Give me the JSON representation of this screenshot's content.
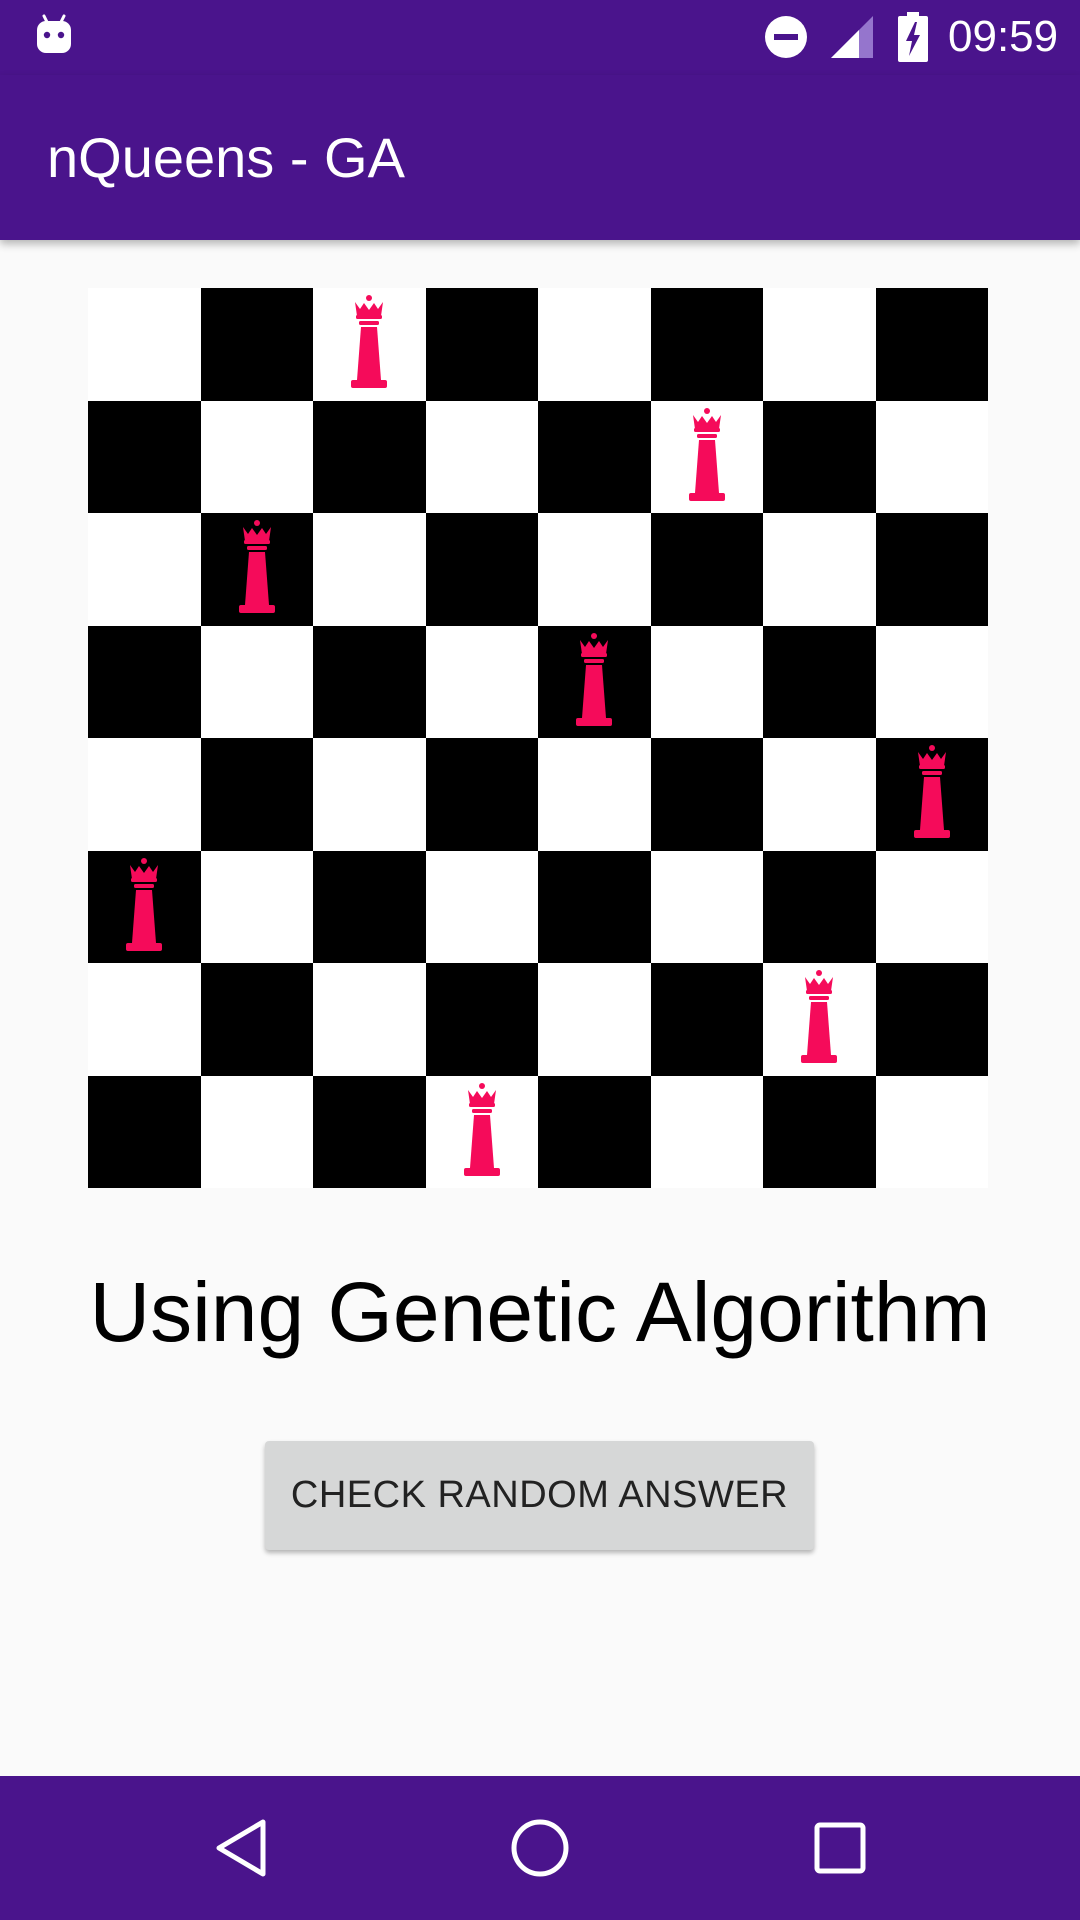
{
  "status_bar": {
    "time": "09:59",
    "icons": [
      "android-debug-icon",
      "do-not-disturb-icon",
      "cell-signal-icon",
      "battery-charging-icon"
    ]
  },
  "app_bar": {
    "title": "nQueens - GA"
  },
  "board": {
    "size": 8,
    "queens": [
      {
        "row": 0,
        "col": 2
      },
      {
        "row": 1,
        "col": 5
      },
      {
        "row": 2,
        "col": 1
      },
      {
        "row": 3,
        "col": 4
      },
      {
        "row": 4,
        "col": 7
      },
      {
        "row": 5,
        "col": 0
      },
      {
        "row": 6,
        "col": 6
      },
      {
        "row": 7,
        "col": 3
      }
    ],
    "piece_icon": "queen-icon",
    "dark_color": "#000000",
    "light_color": "#ffffff",
    "queen_color": "#f50b5a"
  },
  "main": {
    "subtitle": "Using Genetic Algorithm",
    "button_label": "CHECK RANDOM ANSWER"
  },
  "nav_bar": {
    "icons": [
      "back-icon",
      "home-icon",
      "recents-icon"
    ]
  },
  "colors": {
    "primary": "#4a148c",
    "background": "#fafafa",
    "button": "#d6d7d7"
  }
}
